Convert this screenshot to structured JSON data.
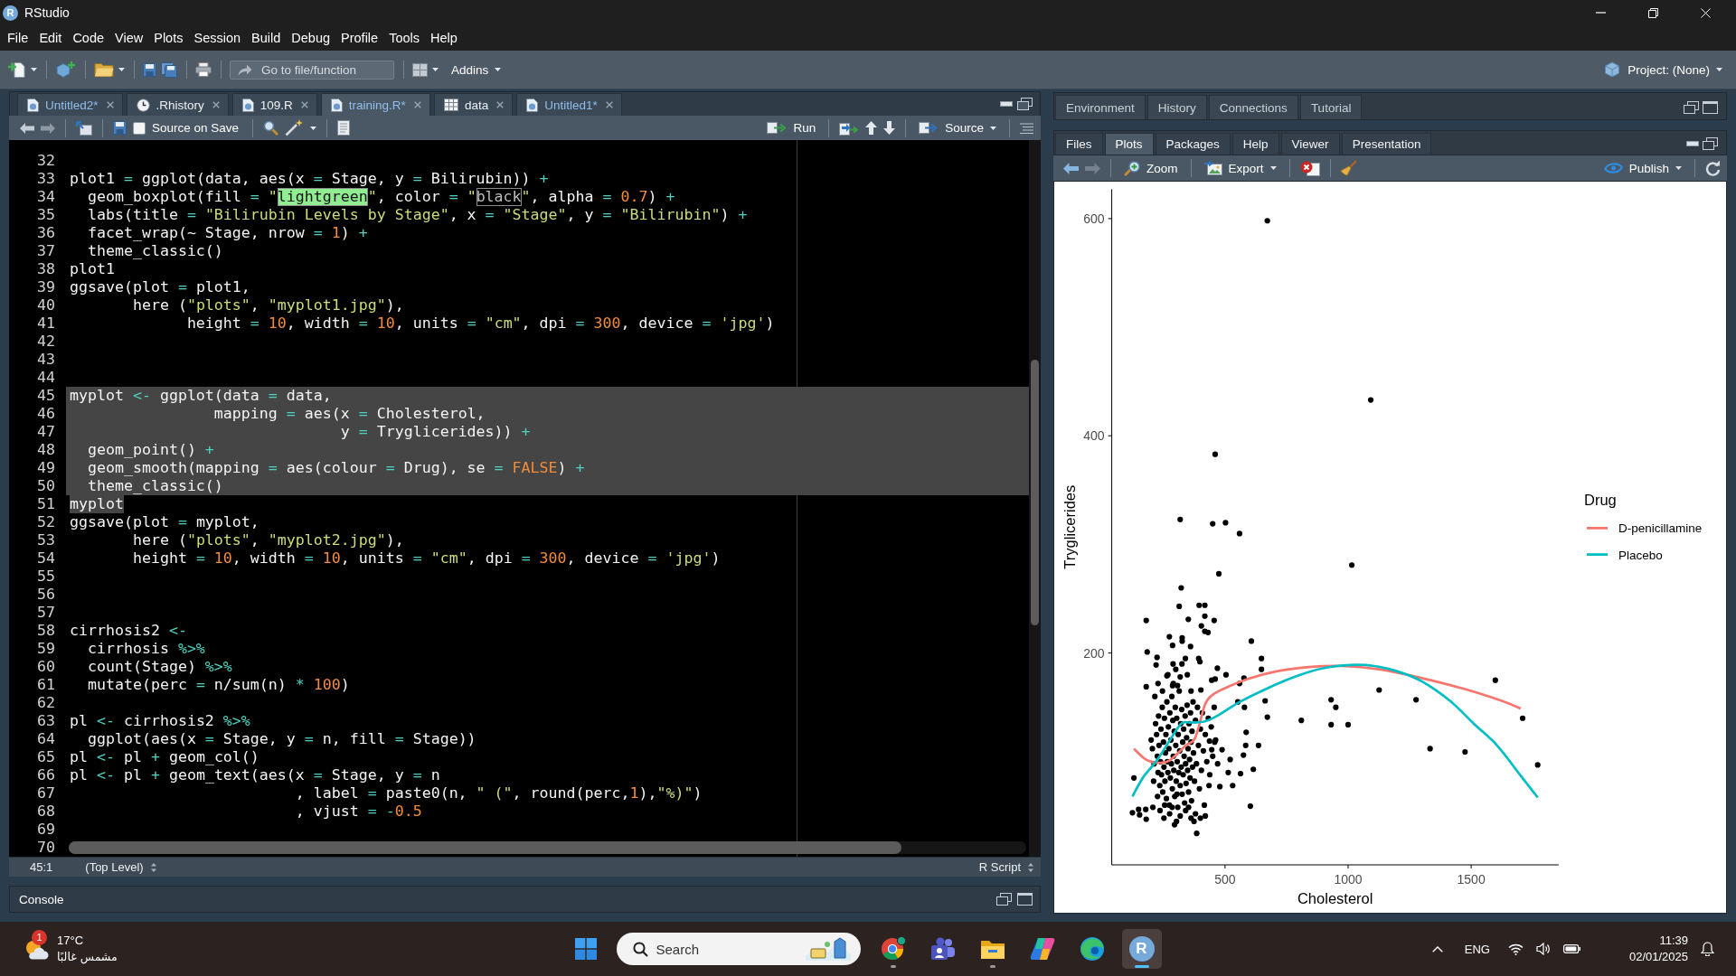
{
  "window": {
    "logo_letter": "R",
    "title": "RStudio"
  },
  "menu": [
    "File",
    "Edit",
    "Code",
    "View",
    "Plots",
    "Session",
    "Build",
    "Debug",
    "Profile",
    "Tools",
    "Help"
  ],
  "toolbar": {
    "goto_field": {
      "placeholder": "Go to file/function"
    },
    "addins": "Addins",
    "project": "Project: (None)"
  },
  "editor": {
    "tabs": [
      {
        "kind": "r-file",
        "label": "Untitled2*",
        "modified": true,
        "selected": false
      },
      {
        "kind": "history",
        "label": ".Rhistory",
        "modified": false,
        "selected": false
      },
      {
        "kind": "r-file",
        "label": "109.R",
        "modified": false,
        "selected": false
      },
      {
        "kind": "r-file",
        "label": "training.R*",
        "modified": true,
        "selected": true
      },
      {
        "kind": "data",
        "label": "data",
        "modified": false,
        "selected": false
      },
      {
        "kind": "r-file",
        "label": "Untitled1*",
        "modified": true,
        "selected": false
      }
    ],
    "source_on_save": {
      "label": "Source on Save",
      "checked": false
    },
    "run": "Run",
    "source": "Source",
    "lines": [
      {
        "number": "32",
        "selected": false
      },
      {
        "number": "33",
        "selected": false,
        "tokens": [
          {
            "kind": "plain",
            "text": "plot1 "
          },
          {
            "kind": "operator",
            "text": "="
          },
          {
            "kind": "plain",
            "text": " ggplot(data, aes(x "
          },
          {
            "kind": "operator",
            "text": "="
          },
          {
            "kind": "plain",
            "text": " Stage, y "
          },
          {
            "kind": "operator",
            "text": "="
          },
          {
            "kind": "plain",
            "text": " Bilirubin)) "
          },
          {
            "kind": "operator",
            "text": "+"
          }
        ]
      },
      {
        "number": "34",
        "selected": false,
        "tokens": [
          {
            "kind": "plain",
            "text": "  geom_boxplot(fill "
          },
          {
            "kind": "operator",
            "text": "="
          },
          {
            "kind": "string",
            "text": " \""
          },
          {
            "kind": "string",
            "text": "lightgreen",
            "color": "#90ee90"
          },
          {
            "kind": "string",
            "text": "\""
          },
          {
            "kind": "plain",
            "text": ", color "
          },
          {
            "kind": "operator",
            "text": "="
          },
          {
            "kind": "string",
            "text": " \""
          },
          {
            "kind": "string",
            "text": "black",
            "color": "#000000"
          },
          {
            "kind": "string",
            "text": "\""
          },
          {
            "kind": "plain",
            "text": ", alpha "
          },
          {
            "kind": "operator",
            "text": "="
          },
          {
            "kind": "number",
            "text": " 0.7"
          },
          {
            "kind": "plain",
            "text": ") "
          },
          {
            "kind": "operator",
            "text": "+"
          }
        ]
      },
      {
        "number": "35",
        "selected": false,
        "tokens": [
          {
            "kind": "plain",
            "text": "  labs(title "
          },
          {
            "kind": "operator",
            "text": "="
          },
          {
            "kind": "string",
            "text": " \"Bilirubin Levels by Stage\""
          },
          {
            "kind": "plain",
            "text": ", x "
          },
          {
            "kind": "operator",
            "text": "="
          },
          {
            "kind": "string",
            "text": " \"Stage\""
          },
          {
            "kind": "plain",
            "text": ", y "
          },
          {
            "kind": "operator",
            "text": "="
          },
          {
            "kind": "string",
            "text": " \"Bilirubin\""
          },
          {
            "kind": "plain",
            "text": ") "
          },
          {
            "kind": "operator",
            "text": "+"
          }
        ]
      },
      {
        "number": "36",
        "selected": false,
        "tokens": [
          {
            "kind": "plain",
            "text": "  facet_wrap(~ Stage, nrow "
          },
          {
            "kind": "operator",
            "text": "="
          },
          {
            "kind": "number",
            "text": " 1"
          },
          {
            "kind": "plain",
            "text": ") "
          },
          {
            "kind": "operator",
            "text": "+"
          }
        ]
      },
      {
        "number": "37",
        "selected": false,
        "tokens": [
          {
            "kind": "plain",
            "text": "  theme_classic()"
          }
        ]
      },
      {
        "number": "38",
        "selected": false,
        "tokens": [
          {
            "kind": "plain",
            "text": "plot1"
          }
        ]
      },
      {
        "number": "39",
        "selected": false,
        "tokens": [
          {
            "kind": "plain",
            "text": "ggsave(plot "
          },
          {
            "kind": "operator",
            "text": "="
          },
          {
            "kind": "plain",
            "text": " plot1,"
          }
        ]
      },
      {
        "number": "40",
        "selected": false,
        "tokens": [
          {
            "kind": "plain",
            "text": "       here ("
          },
          {
            "kind": "string",
            "text": "\"plots\""
          },
          {
            "kind": "plain",
            "text": ", "
          },
          {
            "kind": "string",
            "text": "\"myplot1.jpg\""
          },
          {
            "kind": "plain",
            "text": "),"
          }
        ]
      },
      {
        "number": "41",
        "selected": false,
        "tokens": [
          {
            "kind": "plain",
            "text": "             height "
          },
          {
            "kind": "operator",
            "text": "="
          },
          {
            "kind": "number",
            "text": " 10"
          },
          {
            "kind": "plain",
            "text": ", width "
          },
          {
            "kind": "operator",
            "text": "="
          },
          {
            "kind": "number",
            "text": " 10"
          },
          {
            "kind": "plain",
            "text": ", units "
          },
          {
            "kind": "operator",
            "text": "="
          },
          {
            "kind": "string",
            "text": " \"cm\""
          },
          {
            "kind": "plain",
            "text": ", dpi "
          },
          {
            "kind": "operator",
            "text": "="
          },
          {
            "kind": "number",
            "text": " 300"
          },
          {
            "kind": "plain",
            "text": ", device "
          },
          {
            "kind": "operator",
            "text": "="
          },
          {
            "kind": "string",
            "text": " 'jpg'"
          },
          {
            "kind": "plain",
            "text": ")"
          }
        ]
      },
      {
        "number": "42",
        "selected": false
      },
      {
        "number": "43",
        "selected": false
      },
      {
        "number": "44",
        "selected": false
      },
      {
        "number": "45",
        "selected": true,
        "tokens": [
          {
            "kind": "plain",
            "text": "myplot "
          },
          {
            "kind": "operator",
            "text": "<-"
          },
          {
            "kind": "plain",
            "text": " ggplot(data "
          },
          {
            "kind": "operator",
            "text": "="
          },
          {
            "kind": "plain",
            "text": " data,"
          }
        ]
      },
      {
        "number": "46",
        "selected": true,
        "tokens": [
          {
            "kind": "plain",
            "text": "                mapping "
          },
          {
            "kind": "operator",
            "text": "="
          },
          {
            "kind": "plain",
            "text": " aes(x "
          },
          {
            "kind": "operator",
            "text": "="
          },
          {
            "kind": "plain",
            "text": " Cholesterol,"
          }
        ]
      },
      {
        "number": "47",
        "selected": true,
        "tokens": [
          {
            "kind": "plain",
            "text": "                              y "
          },
          {
            "kind": "operator",
            "text": "="
          },
          {
            "kind": "plain",
            "text": " Tryglicerides)) "
          },
          {
            "kind": "operator",
            "text": "+"
          }
        ]
      },
      {
        "number": "48",
        "selected": true,
        "tokens": [
          {
            "kind": "plain",
            "text": "  geom_point() "
          },
          {
            "kind": "operator",
            "text": "+"
          }
        ]
      },
      {
        "number": "49",
        "selected": true,
        "tokens": [
          {
            "kind": "plain",
            "text": "  geom_smooth(mapping "
          },
          {
            "kind": "operator",
            "text": "="
          },
          {
            "kind": "plain",
            "text": " aes(colour "
          },
          {
            "kind": "operator",
            "text": "="
          },
          {
            "kind": "plain",
            "text": " Drug), se "
          },
          {
            "kind": "operator",
            "text": "="
          },
          {
            "kind": "constant",
            "text": " FALSE"
          },
          {
            "kind": "plain",
            "text": ") "
          },
          {
            "kind": "operator",
            "text": "+"
          }
        ]
      },
      {
        "number": "50",
        "selected": true,
        "tokens": [
          {
            "kind": "plain",
            "text": "  theme_classic()"
          }
        ]
      },
      {
        "number": "51",
        "selected": true,
        "tokens": [
          {
            "kind": "plain",
            "text": "myplot"
          }
        ]
      },
      {
        "number": "52",
        "selected": false,
        "tokens": [
          {
            "kind": "plain",
            "text": "ggsave(plot "
          },
          {
            "kind": "operator",
            "text": "="
          },
          {
            "kind": "plain",
            "text": " myplot,"
          }
        ]
      },
      {
        "number": "53",
        "selected": false,
        "tokens": [
          {
            "kind": "plain",
            "text": "       here ("
          },
          {
            "kind": "string",
            "text": "\"plots\""
          },
          {
            "kind": "plain",
            "text": ", "
          },
          {
            "kind": "string",
            "text": "\"myplot2.jpg\""
          },
          {
            "kind": "plain",
            "text": "),"
          }
        ]
      },
      {
        "number": "54",
        "selected": false,
        "tokens": [
          {
            "kind": "plain",
            "text": "       height "
          },
          {
            "kind": "operator",
            "text": "="
          },
          {
            "kind": "number",
            "text": " 10"
          },
          {
            "kind": "plain",
            "text": ", width "
          },
          {
            "kind": "operator",
            "text": "="
          },
          {
            "kind": "number",
            "text": " 10"
          },
          {
            "kind": "plain",
            "text": ", units "
          },
          {
            "kind": "operator",
            "text": "="
          },
          {
            "kind": "string",
            "text": " \"cm\""
          },
          {
            "kind": "plain",
            "text": ", dpi "
          },
          {
            "kind": "operator",
            "text": "="
          },
          {
            "kind": "number",
            "text": " 300"
          },
          {
            "kind": "plain",
            "text": ", device "
          },
          {
            "kind": "operator",
            "text": "="
          },
          {
            "kind": "string",
            "text": " 'jpg'"
          },
          {
            "kind": "plain",
            "text": ")"
          }
        ]
      },
      {
        "number": "55",
        "selected": false
      },
      {
        "number": "56",
        "selected": false
      },
      {
        "number": "57",
        "selected": false
      },
      {
        "number": "58",
        "selected": false,
        "tokens": [
          {
            "kind": "plain",
            "text": "cirrhosis2 "
          },
          {
            "kind": "operator",
            "text": "<-"
          }
        ]
      },
      {
        "number": "59",
        "selected": false,
        "tokens": [
          {
            "kind": "plain",
            "text": "  cirrhosis "
          },
          {
            "kind": "operator",
            "text": "%>%"
          }
        ]
      },
      {
        "number": "60",
        "selected": false,
        "tokens": [
          {
            "kind": "plain",
            "text": "  count(Stage) "
          },
          {
            "kind": "operator",
            "text": "%>%"
          }
        ]
      },
      {
        "number": "61",
        "selected": false,
        "tokens": [
          {
            "kind": "plain",
            "text": "  mutate(perc "
          },
          {
            "kind": "operator",
            "text": "="
          },
          {
            "kind": "plain",
            "text": " n/sum(n) "
          },
          {
            "kind": "operator",
            "text": "*"
          },
          {
            "kind": "number",
            "text": " 100"
          },
          {
            "kind": "plain",
            "text": ")"
          }
        ]
      },
      {
        "number": "62",
        "selected": false
      },
      {
        "number": "63",
        "selected": false,
        "tokens": [
          {
            "kind": "plain",
            "text": "pl "
          },
          {
            "kind": "operator",
            "text": "<-"
          },
          {
            "kind": "plain",
            "text": " cirrhosis2 "
          },
          {
            "kind": "operator",
            "text": "%>%"
          }
        ]
      },
      {
        "number": "64",
        "selected": false,
        "tokens": [
          {
            "kind": "plain",
            "text": "  ggplot(aes(x "
          },
          {
            "kind": "operator",
            "text": "="
          },
          {
            "kind": "plain",
            "text": " Stage, y "
          },
          {
            "kind": "operator",
            "text": "="
          },
          {
            "kind": "plain",
            "text": " n, fill "
          },
          {
            "kind": "operator",
            "text": "="
          },
          {
            "kind": "plain",
            "text": " Stage))"
          }
        ]
      },
      {
        "number": "65",
        "selected": false,
        "tokens": [
          {
            "kind": "plain",
            "text": "pl "
          },
          {
            "kind": "operator",
            "text": "<-"
          },
          {
            "kind": "plain",
            "text": " pl "
          },
          {
            "kind": "operator",
            "text": "+"
          },
          {
            "kind": "plain",
            "text": " geom_col()"
          }
        ]
      },
      {
        "number": "66",
        "selected": false,
        "tokens": [
          {
            "kind": "plain",
            "text": "pl "
          },
          {
            "kind": "operator",
            "text": "<-"
          },
          {
            "kind": "plain",
            "text": " pl "
          },
          {
            "kind": "operator",
            "text": "+"
          },
          {
            "kind": "plain",
            "text": " geom_text(aes(x "
          },
          {
            "kind": "operator",
            "text": "="
          },
          {
            "kind": "plain",
            "text": " Stage, y "
          },
          {
            "kind": "operator",
            "text": "="
          },
          {
            "kind": "plain",
            "text": " n"
          }
        ]
      },
      {
        "number": "67",
        "selected": false,
        "tokens": [
          {
            "kind": "plain",
            "text": "                         , label "
          },
          {
            "kind": "operator",
            "text": "="
          },
          {
            "kind": "plain",
            "text": " paste0(n, "
          },
          {
            "kind": "string",
            "text": "\" (\""
          },
          {
            "kind": "plain",
            "text": ", round(perc,"
          },
          {
            "kind": "number",
            "text": "1"
          },
          {
            "kind": "plain",
            "text": "),"
          },
          {
            "kind": "string",
            "text": "\"%)\""
          },
          {
            "kind": "plain",
            "text": ")"
          }
        ]
      },
      {
        "number": "68",
        "selected": false,
        "tokens": [
          {
            "kind": "plain",
            "text": "                         , vjust "
          },
          {
            "kind": "operator",
            "text": "="
          },
          {
            "kind": "operator",
            "text": " -"
          },
          {
            "kind": "number",
            "text": "0.5"
          }
        ]
      },
      {
        "number": "69",
        "selected": false
      },
      {
        "number": "70",
        "selected": false
      }
    ],
    "status": {
      "position": "45:1",
      "scope": "(Top Level)",
      "file_type": "R Script"
    }
  },
  "console": {
    "title": "Console"
  },
  "upper_right_pane": {
    "tabs": [
      {
        "label": "Environment",
        "selected": false
      },
      {
        "label": "History",
        "selected": false
      },
      {
        "label": "Connections",
        "selected": false
      },
      {
        "label": "Tutorial",
        "selected": false
      }
    ]
  },
  "lower_right_pane": {
    "tabs": [
      {
        "label": "Files",
        "selected": false
      },
      {
        "label": "Plots",
        "selected": true
      },
      {
        "label": "Packages",
        "selected": false
      },
      {
        "label": "Help",
        "selected": false
      },
      {
        "label": "Viewer",
        "selected": false
      },
      {
        "label": "Presentation",
        "selected": false
      }
    ],
    "toolbar": {
      "zoom": "Zoom",
      "export": "Export",
      "publish": "Publish"
    },
    "legend_title": "Drug",
    "chart_data": {
      "type": "scatter",
      "xlabel": "Cholesterol",
      "ylabel": "Tryglicerides",
      "xlim": [
        40,
        1855
      ],
      "ylim": [
        5,
        627
      ],
      "xticks": [
        500,
        1000,
        1500
      ],
      "yticks": [
        200,
        400,
        600
      ],
      "legend": "right",
      "series": [
        {
          "color": "#000000",
          "x": [
            672,
            1092,
            460,
            318,
            450,
            502,
            559,
            475,
            1015,
            322,
            314,
            395,
            418,
            180,
            351,
            456,
            404,
            418,
            418,
            431,
            274,
            326,
            326,
            607,
            287,
            360,
            184,
            224,
            220,
            339,
            289,
            393,
            398,
            648,
            648,
            469,
            504,
            264,
            318,
            347,
            446,
            460,
            559,
            577,
            180,
            287,
            307,
            362,
            402,
            1126,
            1598,
            931,
            950,
            1276,
            663,
            552,
            579,
            810,
            672,
            931,
            1000,
            1709,
            586,
            584,
            636,
            575,
            521,
            513,
            531,
            563,
            615,
            1333,
            1475,
            1770,
            488,
            458,
            437,
            446,
            479,
            435,
            603,
            385,
            303,
            374,
            130,
            124,
            149,
            178,
            207,
            153,
            180,
            200,
            205,
            212,
            218,
            222,
            225,
            228,
            230,
            232,
            235,
            238,
            240,
            242,
            245,
            247,
            250,
            252,
            254,
            256,
            258,
            260,
            262,
            264,
            266,
            268,
            270,
            272,
            274,
            276,
            278,
            280,
            282,
            284,
            286,
            288,
            290,
            292,
            294,
            296,
            298,
            300,
            302,
            304,
            306,
            308,
            310,
            312,
            314,
            316,
            318,
            320,
            322,
            324,
            326,
            328,
            330,
            332,
            334,
            336,
            338,
            340,
            342,
            344,
            346,
            348,
            350,
            352,
            354,
            356,
            358,
            360,
            362,
            364,
            366,
            368,
            370,
            372,
            376,
            380,
            384,
            388,
            392,
            396,
            400,
            404,
            408,
            412,
            416,
            420,
            426,
            432,
            438,
            444,
            450,
            456,
            462,
            470,
            215,
            228,
            246,
            268,
            290,
            236,
            252,
            275,
            295,
            318,
            340,
            362,
            380,
            300,
            325,
            210,
            226,
            255,
            285,
            305,
            352,
            400,
            420
          ],
          "values": [
            598,
            433,
            383,
            323,
            319,
            320,
            310,
            273,
            281,
            260,
            243,
            244,
            244,
            230,
            231,
            230,
            225,
            234,
            220,
            219,
            215,
            214,
            211,
            211,
            207,
            206,
            201,
            196,
            189,
            195,
            190,
            195,
            192,
            195,
            185,
            186,
            180,
            179,
            178,
            180,
            175,
            176,
            172,
            177,
            169,
            170,
            170,
            165,
            166,
            166,
            175,
            157,
            150,
            157,
            156,
            155,
            150,
            138,
            141,
            134,
            134,
            140,
            127,
            115,
            115,
            106,
            102,
            90,
            78,
            89,
            93,
            112,
            109,
            97,
            111,
            118,
            119,
            111,
            77,
            78,
            59,
            34,
            45,
            45,
            85,
            53,
            56,
            56,
            58,
            51,
            47,
            120,
            112,
            98,
            135,
            125,
            105,
            90,
            142,
            115,
            78,
            100,
            130,
            88,
            150,
            72,
            118,
            95,
            140,
            82,
            108,
            125,
            66,
            155,
            100,
            90,
            132,
            112,
            60,
            145,
            85,
            120,
            98,
            160,
            75,
            138,
            105,
            92,
            128,
            68,
            150,
            115,
            82,
            140,
            100,
            58,
            125,
            90,
            165,
            110,
            78,
            135,
            95,
            148,
            70,
            118,
            88,
            130,
            105,
            62,
            142,
            98,
            80,
            122,
            152,
            92,
            112,
            72,
            135,
            102,
            85,
            145,
            118,
            64,
            128,
            95,
            155,
            108,
            82,
            138,
            98,
            150,
            115,
            75,
            130,
            92,
            145,
            110,
            60,
            125,
            100,
            140,
            88,
            132,
            105,
            150,
            120,
            98,
            160,
            172,
            165,
            180,
            172,
            55,
            48,
            52,
            42,
            50,
            55,
            48,
            52,
            185,
            190,
            82,
            68,
            60,
            58,
            70,
            58,
            48,
            50
          ]
        },
        {
          "type": "line",
          "name": "D-penicillamine",
          "color": "#f8766d",
          "x": [
            130,
            178,
            226,
            274,
            341,
            379,
            418,
            447,
            494,
            590,
            705,
            839,
            974,
            1126,
            1280,
            1471,
            1624,
            1701
          ],
          "values": [
            112,
            102,
            99,
            101,
            115,
            122,
            152,
            161,
            167,
            176,
            183,
            187,
            188,
            185,
            178,
            167,
            156,
            149
          ]
        },
        {
          "type": "line",
          "name": "Placebo",
          "color": "#00bfc4",
          "x": [
            124,
            169,
            226,
            274,
            322,
            360,
            418,
            475,
            552,
            648,
            782,
            897,
            1011,
            1107,
            1203,
            1299,
            1414,
            1510,
            1605,
            1701,
            1770
          ],
          "values": [
            68,
            86,
            102,
            119,
            135,
            136,
            137,
            143,
            154,
            165,
            178,
            186,
            189,
            188,
            183,
            174,
            156,
            135,
            115,
            87,
            67
          ]
        }
      ]
    }
  },
  "taskbar": {
    "weather": {
      "badge": "1",
      "temperature": "17°C",
      "condition": "مشمس غالبًا"
    },
    "search": {
      "placeholder": "Search"
    },
    "apps": [
      {
        "kind": "ring-browser",
        "running": true,
        "active": false
      },
      {
        "kind": "chat",
        "running": false,
        "active": false
      },
      {
        "kind": "folder",
        "running": true,
        "active": false
      },
      {
        "kind": "assistant",
        "running": false,
        "active": false
      },
      {
        "kind": "wave-browser",
        "running": false,
        "active": false
      },
      {
        "kind": "r-app",
        "letter": "R",
        "running": true,
        "active": true
      }
    ],
    "language": "ENG",
    "time": "11:39",
    "date": "02/01/2025"
  }
}
